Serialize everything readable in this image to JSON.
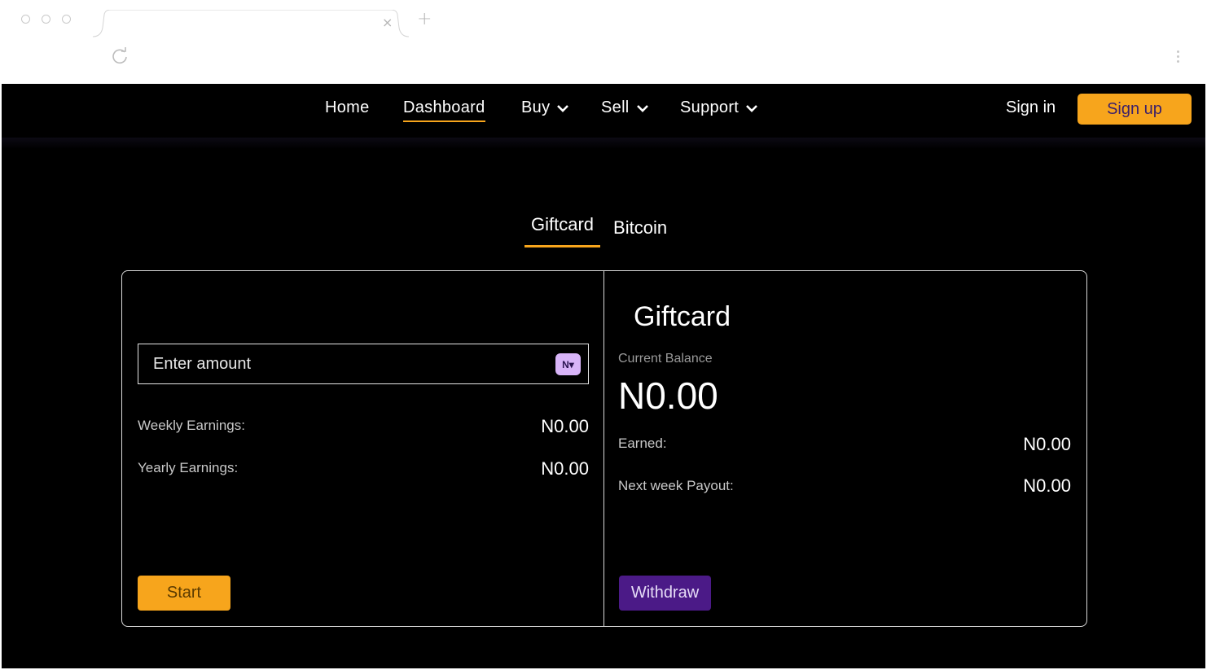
{
  "browser": {
    "tab_close": "×",
    "tab_new": "+"
  },
  "nav": {
    "links": [
      {
        "label": "Home"
      },
      {
        "label": "Dashboard"
      },
      {
        "label": "Buy"
      },
      {
        "label": "Sell"
      },
      {
        "label": "Support"
      }
    ],
    "active": "Dashboard",
    "signin": "Sign in",
    "signup": "Sign up"
  },
  "tabs": {
    "items": [
      "Giftcard",
      "Bitcoin"
    ],
    "active": "Giftcard"
  },
  "calculator": {
    "amount_placeholder": "Enter amount",
    "amount_value": "",
    "currency": "N▾",
    "weekly_label": "Weekly Earnings:",
    "weekly_value": "N0.00",
    "yearly_label": "Yearly Earnings:",
    "yearly_value": "N0.00",
    "start_label": "Start"
  },
  "wallet": {
    "title": "Giftcard",
    "balance_label": "Current Balance",
    "balance_value": "N0.00",
    "earned_label": "Earned:",
    "earned_value": "N0.00",
    "payout_label": "Next week Payout:",
    "payout_value": "N0.00",
    "withdraw_label": "Withdraw"
  },
  "colors": {
    "accent": "#f7a51c",
    "purple": "#4b1a87",
    "background": "#000000"
  }
}
